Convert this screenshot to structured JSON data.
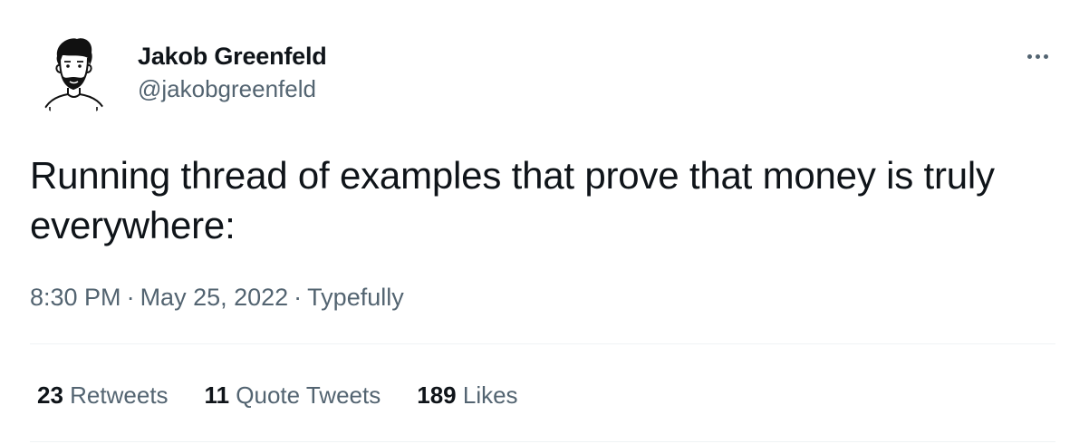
{
  "author": {
    "display_name": "Jakob Greenfeld",
    "handle": "@jakobgreenfeld",
    "avatar_icon": "cartoon-avatar-icon"
  },
  "more_icon": "more-options-icon",
  "tweet": {
    "text": "Running thread of examples that prove that money is truly everywhere:"
  },
  "meta": {
    "time": "8:30 PM",
    "separator": "·",
    "date": "May 25, 2022",
    "source": "Typefully"
  },
  "stats": [
    {
      "count": "23",
      "label": "Retweets"
    },
    {
      "count": "11",
      "label": "Quote Tweets"
    },
    {
      "count": "189",
      "label": "Likes"
    }
  ],
  "colors": {
    "text_primary": "#0f1419",
    "text_secondary": "#536471",
    "divider": "#eff3f4",
    "background": "#ffffff"
  }
}
